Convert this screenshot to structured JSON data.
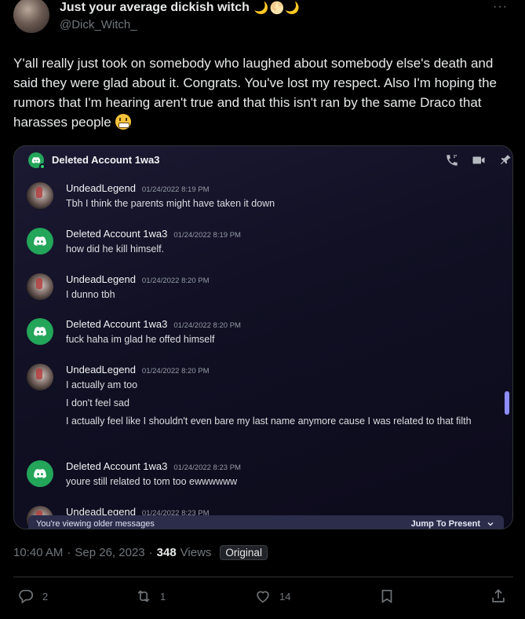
{
  "author": {
    "display_name": "Just your average dickish witch",
    "name_emoji": "🌙🌕🌙",
    "handle": "@Dick_Witch_"
  },
  "tweet": {
    "text": "Y'all really just took on somebody who laughed about somebody else's death and said they were glad about it. Congrats. You've lost my respect. Also I'm hoping the rumors that I'm hearing aren't true and that this isn't ran by the same Draco that harasses people",
    "emoji_icon": "grimacing-face-icon"
  },
  "discord": {
    "channel_title": "Deleted Account 1wa3",
    "messages": [
      {
        "author": "UndeadLegend",
        "time": "01/24/2022 8:19 PM",
        "avatar": "undead",
        "lines": [
          "Tbh I think the parents might have taken it down"
        ]
      },
      {
        "author": "Deleted Account 1wa3",
        "time": "01/24/2022 8:19 PM",
        "avatar": "discord",
        "lines": [
          "how did he kill himself."
        ]
      },
      {
        "author": "UndeadLegend",
        "time": "01/24/2022 8:20 PM",
        "avatar": "undead",
        "lines": [
          "I dunno tbh"
        ]
      },
      {
        "author": "Deleted Account 1wa3",
        "time": "01/24/2022 8:20 PM",
        "avatar": "discord",
        "lines": [
          "fuck haha im glad he offed himself"
        ]
      },
      {
        "author": "UndeadLegend",
        "time": "01/24/2022 8:20 PM",
        "avatar": "undead",
        "lines": [
          "I actually am too",
          "I don't feel sad",
          "I actually feel like I shouldn't even bare my last name anymore cause I was related to that filth"
        ]
      },
      {
        "author": "Deleted Account 1wa3",
        "time": "01/24/2022 8:23 PM",
        "avatar": "discord",
        "lines": [
          "youre still related to tom too ewwwwww"
        ]
      },
      {
        "author": "UndeadLegend",
        "time": "01/24/2022 8:23 PM",
        "avatar": "undead",
        "lines": []
      }
    ],
    "older_messages_label": "You're viewing older messages",
    "jump_label": "Jump To Present"
  },
  "meta": {
    "time": "10:40 AM",
    "separator": "·",
    "date": "Sep 26, 2023",
    "views_count": "348",
    "views_label": "Views",
    "badge": "Original"
  },
  "actions": {
    "replies": "2",
    "reposts": "1",
    "likes": "14"
  },
  "colors": {
    "discord_green": "#23a55a",
    "scroll_accent": "#8d8cff"
  }
}
